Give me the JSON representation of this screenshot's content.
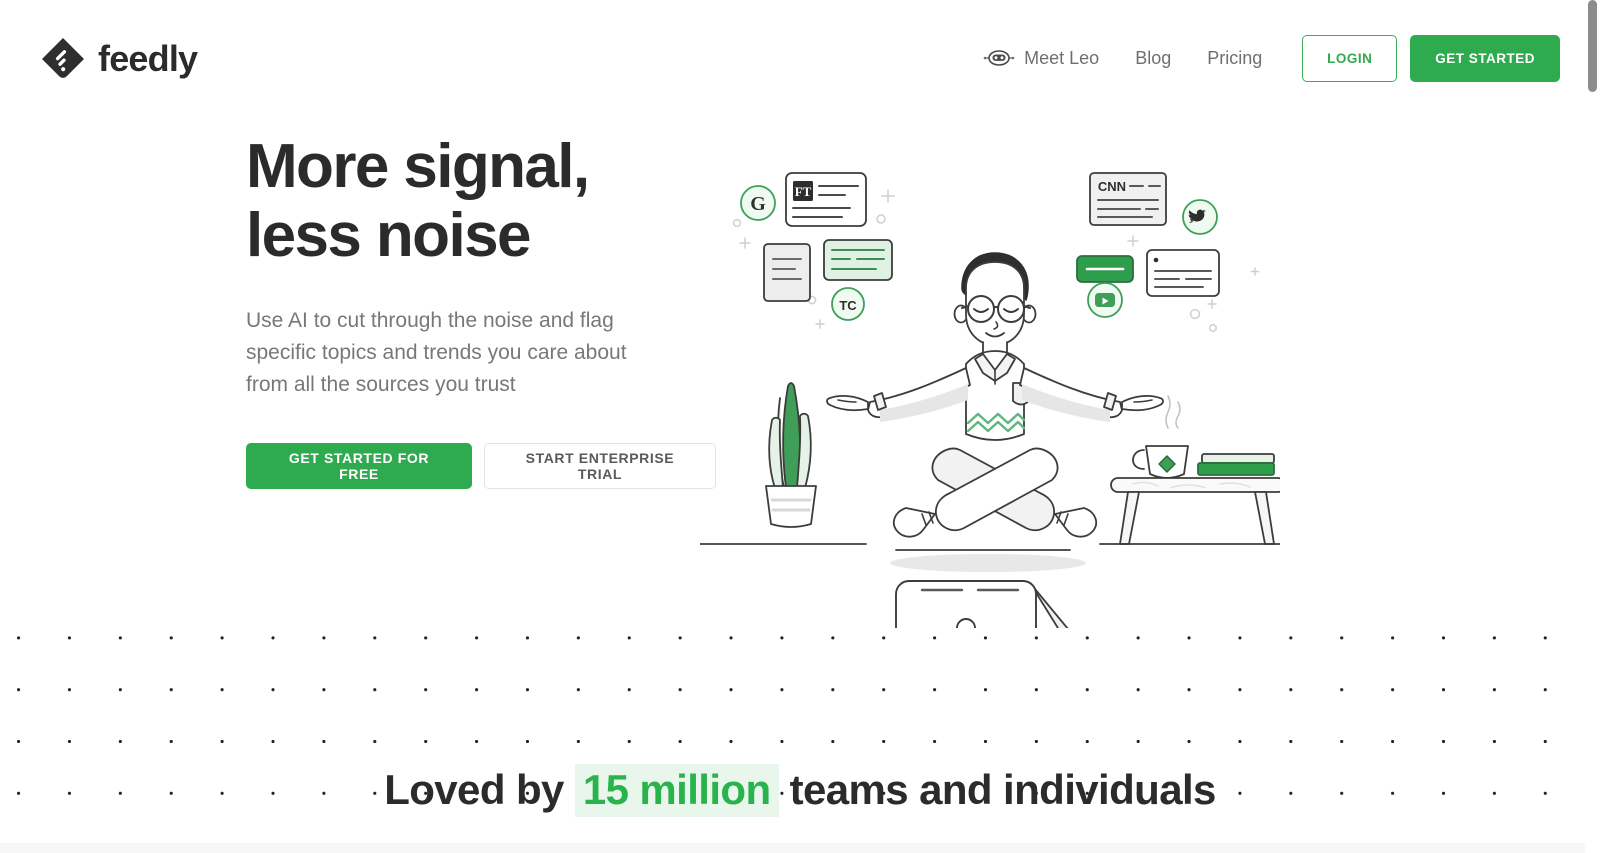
{
  "brand": {
    "name": "feedly",
    "logo_icon": "feedly-diamond-logo-icon",
    "accent_green": "#2fab4f",
    "accent_green_text": "#2ab34c",
    "highlight_green_bg": "#e9f6ec",
    "dark_text": "#2b2b2b",
    "muted_text": "#787878"
  },
  "header": {
    "nav": [
      {
        "id": "meet-leo",
        "label": "Meet Leo",
        "icon": "leo-robot-icon"
      },
      {
        "id": "blog",
        "label": "Blog",
        "icon": null
      },
      {
        "id": "pricing",
        "label": "Pricing",
        "icon": null
      }
    ],
    "login_label": "LOGIN",
    "get_started_label": "GET STARTED"
  },
  "hero": {
    "title": "More signal,\nless noise",
    "subtitle": "Use AI to cut through the noise and flag specific topics and trends you care about from all the sources you trust",
    "primary_cta": "GET STARTED FOR FREE",
    "secondary_cta": "START ENTERPRISE TRIAL"
  },
  "illustration": {
    "alt": "Person meditating surrounded by floating news cards and source badges",
    "source_badges": [
      {
        "id": "google-news",
        "label": "G",
        "style": "green-circle"
      },
      {
        "id": "financial-times",
        "label": "FT",
        "style": "dark-square-on-card"
      },
      {
        "id": "techcrunch",
        "label": "TC",
        "style": "green-circle"
      },
      {
        "id": "cnn",
        "label": "CNN",
        "style": "dark-text-on-card"
      },
      {
        "id": "twitter",
        "label": "bird",
        "style": "green-circle"
      },
      {
        "id": "youtube",
        "label": "play",
        "style": "green-circle"
      }
    ],
    "props": [
      "snake-plant",
      "side-table",
      "coffee-cup",
      "stacked-books",
      "laptop-with-feedly-sticker"
    ]
  },
  "social_proof": {
    "prefix": "Loved by ",
    "highlight": "15 million",
    "suffix": " teams and individuals"
  },
  "scrollbar": {
    "position_label": "top"
  }
}
